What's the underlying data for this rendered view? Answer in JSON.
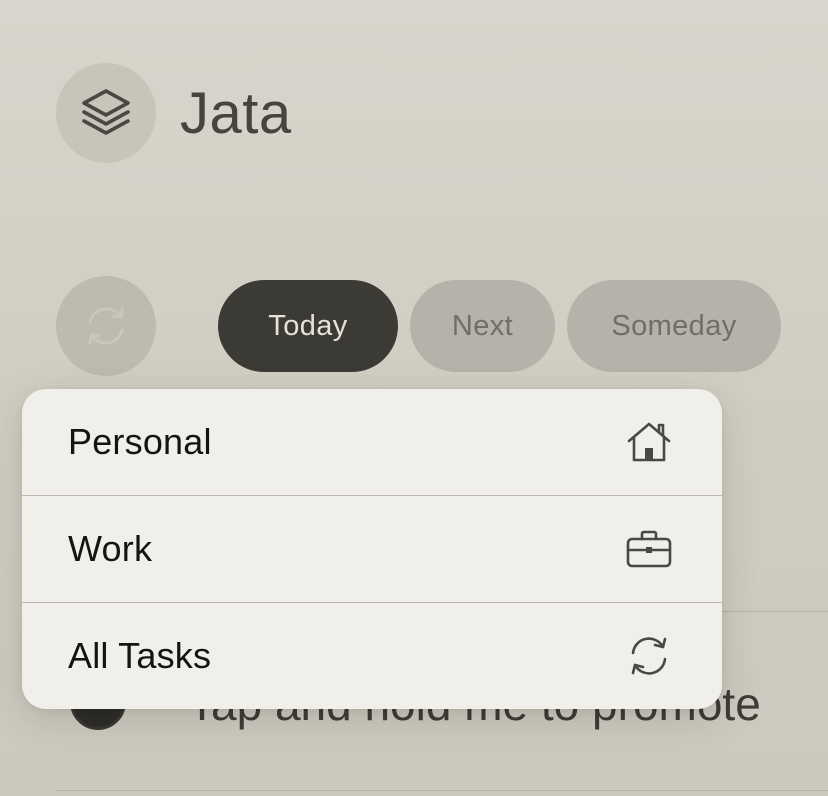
{
  "app": {
    "title": "Jata",
    "logo_icon": "stack-layers-icon"
  },
  "filters": {
    "sync_icon": "sync-icon",
    "tabs": [
      {
        "label": "Today",
        "selected": true
      },
      {
        "label": "Next",
        "selected": false
      },
      {
        "label": "Someday",
        "selected": false
      }
    ]
  },
  "task": {
    "text": "Tap and hold me to promote"
  },
  "menu": {
    "items": [
      {
        "label": "Personal",
        "icon": "house-icon"
      },
      {
        "label": "Work",
        "icon": "briefcase-icon"
      },
      {
        "label": "All Tasks",
        "icon": "sync-icon"
      }
    ]
  },
  "colors": {
    "background": "#d3d0c6",
    "tab_selected": "#3c3a35",
    "tab_unselected": "#b5b2a9",
    "menu_background": "#f0efea"
  }
}
